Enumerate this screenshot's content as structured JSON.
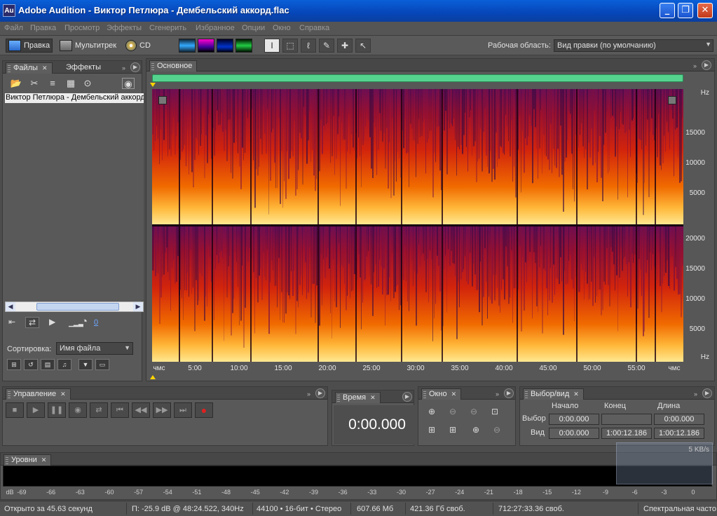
{
  "window": {
    "app_icon": "Au",
    "title": "Adobe Audition - Виктор Петлюра  - Дембельский аккорд.flac",
    "minimize": "_",
    "maximize": "❐",
    "close": "✕"
  },
  "menu": [
    "Файл",
    "Правка",
    "Просмотр",
    "Эффекты",
    "Сгенерить",
    "Избранное",
    "Опции",
    "Окно",
    "Справка"
  ],
  "toolbar": {
    "modes": [
      "Правка",
      "Мультитрек",
      "CD"
    ],
    "workspace_label": "Рабочая область:",
    "workspace_value": "Вид правки (по умолчанию)"
  },
  "files_panel": {
    "tabs": [
      "Файлы",
      "Эффекты"
    ],
    "files": [
      "Виктор Петлюра  - Дембельский аккорд.flac"
    ],
    "transport_value": "0",
    "sort_label": "Сортировка:",
    "sort_value": "Имя файла"
  },
  "main_panel": {
    "tab": "Основное"
  },
  "spectrogram": {
    "freq_unit": "Hz",
    "top_channel_ticks": [
      "15000",
      "10000",
      "5000"
    ],
    "bottom_channel_ticks": [
      "20000",
      "15000",
      "10000",
      "5000"
    ],
    "time_ticks": [
      "чмс",
      "5:00",
      "10:00",
      "15:00",
      "20:00",
      "25:00",
      "30:00",
      "35:00",
      "40:00",
      "45:00",
      "50:00",
      "55:00",
      "чмс"
    ]
  },
  "transport_panel": {
    "tab": "Управление"
  },
  "time_panel": {
    "tab": "Время",
    "value": "0:00.000"
  },
  "zoom_panel": {
    "tab": "Окно"
  },
  "selection_panel": {
    "tab": "Выбор/вид",
    "headers": [
      "Начало",
      "Конец",
      "Длина"
    ],
    "selection_label": "Выбор",
    "view_label": "Вид",
    "selection": {
      "start": "0:00.000",
      "end": "",
      "length": "0:00.000"
    },
    "view": {
      "start": "0:00.000",
      "end": "1:00:12.186",
      "length": "1:00:12.186"
    }
  },
  "levels_panel": {
    "tab": "Уровни",
    "scale": [
      "dB",
      "-69",
      "-66",
      "-63",
      "-60",
      "-57",
      "-54",
      "-51",
      "-48",
      "-45",
      "-42",
      "-39",
      "-36",
      "-33",
      "-30",
      "-27",
      "-24",
      "-21",
      "-18",
      "-15",
      "-12",
      "-9",
      "-6",
      "-3",
      "0"
    ],
    "net_speed": "5 KB/s"
  },
  "status": {
    "opened": "Открыто за 45.63 секунд",
    "cursor": "П: -25.9 dB @  48:24.522, 340Hz",
    "format": "44100 • 16-бит • Стерео",
    "size": "607.66 Мб",
    "free_space": "421.36 Гб своб.",
    "free_time": "712:27:33.36 своб.",
    "view_mode": "Спектральная часто"
  }
}
